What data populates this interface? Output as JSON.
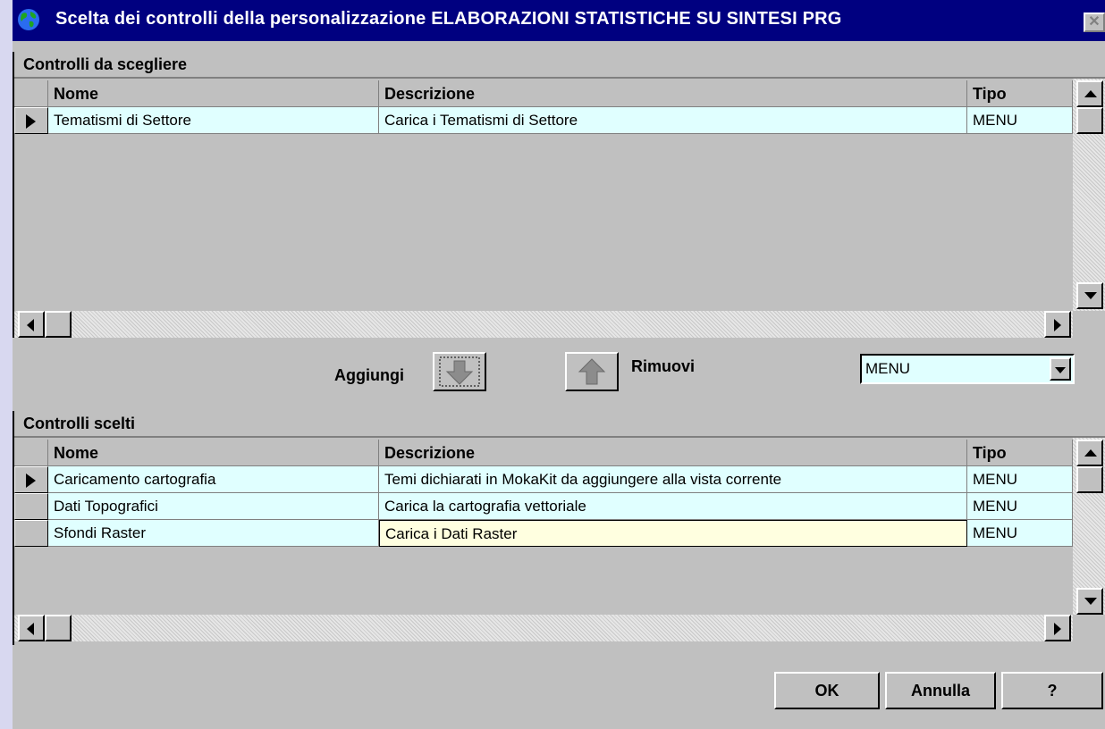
{
  "window": {
    "title": "Scelta dei controlli della personalizzazione  ELABORAZIONI STATISTICHE SU SINTESI PRG",
    "close_label": "✕"
  },
  "grid_available": {
    "caption": "Controlli da scegliere",
    "headers": {
      "nome": "Nome",
      "descrizione": "Descrizione",
      "tipo": "Tipo"
    },
    "rows": [
      {
        "nome": "Tematismi di Settore",
        "descrizione": "Carica i Tematismi di Settore",
        "tipo": "MENU"
      }
    ]
  },
  "actions": {
    "add_label": "Aggiungi",
    "remove_label": "Rimuovi",
    "type_filter": "MENU"
  },
  "grid_selected": {
    "caption": "Controlli scelti",
    "headers": {
      "nome": "Nome",
      "descrizione": "Descrizione",
      "tipo": "Tipo"
    },
    "rows": [
      {
        "nome": "Caricamento cartografia",
        "descrizione": "Temi dichiarati in MokaKit da aggiungere alla vista corrente",
        "tipo": "MENU"
      },
      {
        "nome": "Dati Topografici",
        "descrizione": "Carica la cartografia vettoriale",
        "tipo": "MENU"
      },
      {
        "nome": "Sfondi Raster",
        "descrizione": "Carica i Dati Raster",
        "tipo": "MENU"
      }
    ]
  },
  "footer": {
    "ok_label": "OK",
    "cancel_label": "Annulla",
    "help_label": "?"
  },
  "colors": {
    "titlebar": "#000080",
    "row_bg": "#e0ffff",
    "current_cell": "#ffffe0",
    "face": "#c0c0c0"
  }
}
